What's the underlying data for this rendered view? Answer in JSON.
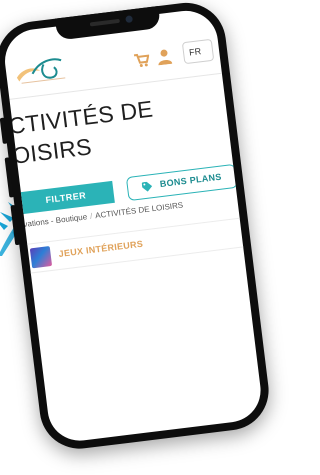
{
  "header": {
    "lang_label": "FR"
  },
  "page": {
    "title_line1": "CTIVITÉS DE",
    "title_line2": "OISIRS"
  },
  "actions": {
    "filter_label": "FILTRER",
    "deals_label": "BONS PLANS"
  },
  "breadcrumb": {
    "parent": "rvations - Boutique",
    "current": "ACTIVITÉS DE LOISIRS"
  },
  "categories": [
    {
      "label": "JEUX INTÉRIEURS"
    }
  ],
  "colors": {
    "accent": "#2bb3b7",
    "category_text": "#e0a25a",
    "phone_frame": "#0d0d0d"
  },
  "icons": {
    "cart": "cart-icon",
    "user": "user-icon",
    "tag": "tag-icon",
    "palm": "palm-leaf-icon"
  }
}
